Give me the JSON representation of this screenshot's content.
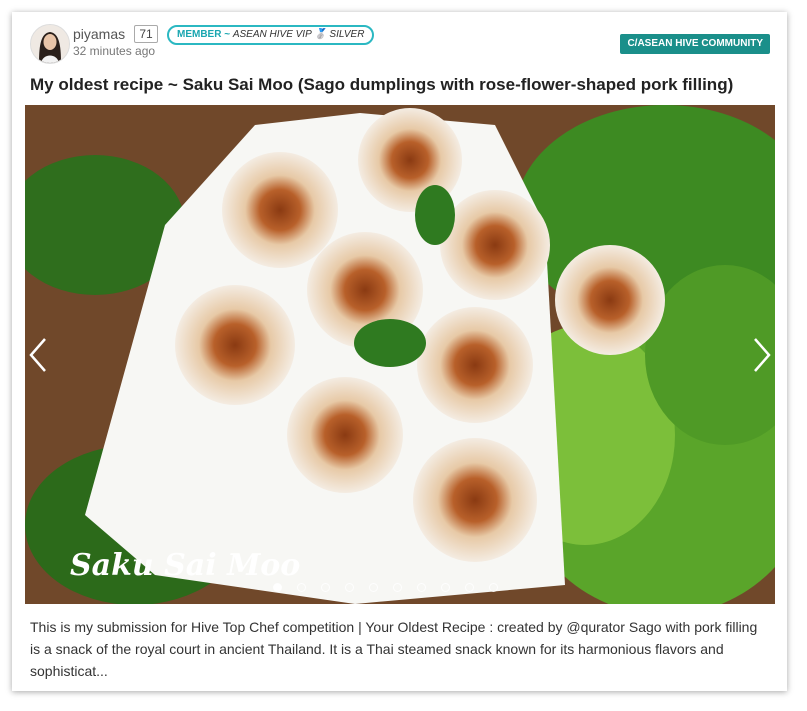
{
  "post": {
    "author": "piyamas",
    "reputation": "71",
    "badge_prefix": "MEMBER ~",
    "badge_text": "ASEAN HIVE VIP 🥈 SILVER",
    "time": "32 minutes ago",
    "community": "C/ASEAN HIVE COMMUNITY",
    "title": "My oldest recipe ~ Saku Sai Moo (Sago dumplings with rose-flower-shaped pork filling)",
    "image_caption": "Saku Sai Moo",
    "excerpt": "This is my submission for Hive Top Chef competition | Your Oldest Recipe : created by @qurator Sago with pork filling is a snack of the royal court in ancient Thailand. It is a Thai steamed snack known for its harmonious flavors and sophisticat..."
  },
  "carousel": {
    "slide_count": 10,
    "active_index": 0,
    "prev_icon": "chevron-left-icon",
    "next_icon": "chevron-right-icon"
  },
  "colors": {
    "badge_border": "#2bb8c2",
    "community_bg": "#1a8f8a"
  }
}
